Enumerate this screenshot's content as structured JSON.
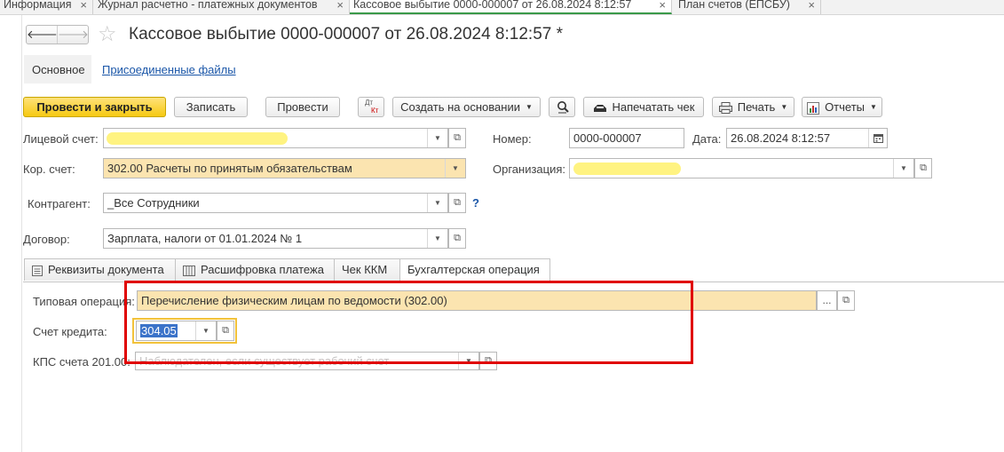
{
  "window_tabs": [
    {
      "label": "Информация"
    },
    {
      "label": "Журнал расчетно - платежных документов"
    },
    {
      "label": "Кассовое выбытие 0000-000007 от 26.08.2024 8:12:57"
    },
    {
      "label": "План счетов (ЕПСБУ)"
    }
  ],
  "header": {
    "title": "Кассовое выбытие 0000-000007 от 26.08.2024 8:12:57 *"
  },
  "nav": {
    "main": "Основное",
    "attached": "Присоединенные файлы"
  },
  "toolbar": {
    "post_close": "Провести и закрыть",
    "save": "Записать",
    "post": "Провести",
    "dtkt_top": "Дт",
    "dtkt_bottom": "Кт",
    "create_based": "Создать на основании",
    "print_check": "Напечатать чек",
    "print": "Печать",
    "reports": "Отчеты"
  },
  "form": {
    "personal_account_label": "Лицевой счет:",
    "number_label": "Номер:",
    "number_value": "0000-000007",
    "date_label": "Дата:",
    "date_value": "26.08.2024  8:12:57",
    "cor_account_label": "Кор. счет:",
    "cor_account_value": "302.00 Расчеты по принятым обязательствам",
    "organization_label": "Организация:",
    "counterparty_label": "Контрагент:",
    "counterparty_value": "_Все Сотрудники",
    "help": "?",
    "contract_label": "Договор:",
    "contract_value": "Зарплата, налоги от 01.01.2024 № 1"
  },
  "doc_tabs": [
    {
      "label": "Реквизиты документа"
    },
    {
      "label": "Расшифровка платежа"
    },
    {
      "label": "Чек ККМ"
    },
    {
      "label": "Бухгалтерская операция"
    }
  ],
  "operation": {
    "type_label": "Типовая операция:",
    "type_value": "Перечисление физическим лицам по ведомости (302.00)",
    "ellipsis": "...",
    "credit_label": "Счет кредита:",
    "credit_value": "304.05",
    "kps_label": "КПС счета 201.00:",
    "kps_placeholder": "Наблюдателен, если существует рабочий счет"
  },
  "colors": {
    "primary_button": "#f6c912",
    "required_field": "#fbe4b0",
    "annotation_box": "#e00000",
    "active_tab_underline": "#3a9a4a"
  }
}
